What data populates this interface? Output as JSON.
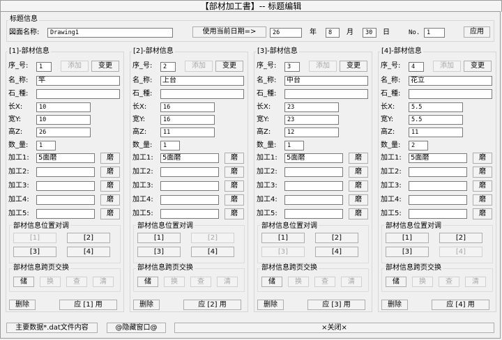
{
  "window": {
    "title": "【部材加工書】-- 标题编辑"
  },
  "header": {
    "group_title": "标题信息",
    "drawing_name_label": "図面名称:",
    "drawing_name_value": "Drawing1",
    "use_date_button": "使用当前日期=>",
    "year_value": "26",
    "year_label": "年",
    "month_value": "8",
    "month_label": "月",
    "day_value": "30",
    "day_label": "日",
    "no_label": "No.",
    "no_value": "1",
    "apply_button": "应用"
  },
  "labels": {
    "seq": "序_号:",
    "add": "添加",
    "change": "变更",
    "name": "名_称:",
    "stone": "石_種:",
    "length": "长X:",
    "width": "宽Y:",
    "height": "高Z:",
    "qty": "数_量:",
    "process": [
      "加工1:",
      "加工2:",
      "加工3:",
      "加工4:",
      "加工5:"
    ],
    "polish": "磨",
    "position_swap": "部材信息位置对调",
    "page_swap": "部材信息跨页交换",
    "swap_buttons": [
      "储",
      "换",
      "查",
      "清"
    ],
    "delete": "删除"
  },
  "panels": [
    {
      "title": "[1]-部材信息",
      "seq": "1",
      "name": "竿",
      "stone": "",
      "x": "10",
      "y": "10",
      "z": "26",
      "qty": "1",
      "process": [
        "5面磨",
        "",
        "",
        "",
        ""
      ],
      "pos_buttons": [
        "[1]",
        "[2]",
        "[3]",
        "[4]"
      ],
      "apply": "应 [1] 用"
    },
    {
      "title": "[2]-部材信息",
      "seq": "2",
      "name": "上台",
      "stone": "",
      "x": "16",
      "y": "16",
      "z": "11",
      "qty": "1",
      "process": [
        "5面磨",
        "",
        "",
        "",
        ""
      ],
      "pos_buttons": [
        "[1]",
        "[2]",
        "[3]",
        "[4]"
      ],
      "apply": "应 [2] 用"
    },
    {
      "title": "[3]-部材信息",
      "seq": "3",
      "name": "中台",
      "stone": "",
      "x": "23",
      "y": "23",
      "z": "12",
      "qty": "1",
      "process": [
        "5面磨",
        "",
        "",
        "",
        ""
      ],
      "pos_buttons": [
        "[1]",
        "[2]",
        "[3]",
        "[4]"
      ],
      "apply": "应 [3] 用"
    },
    {
      "title": "[4]-部材信息",
      "seq": "4",
      "name": "花立",
      "stone": "",
      "x": "5.5",
      "y": "5.5",
      "z": "11",
      "qty": "2",
      "process": [
        "5面磨",
        "",
        "",
        "",
        ""
      ],
      "pos_buttons": [
        "[1]",
        "[2]",
        "[3]",
        "[4]"
      ],
      "apply": "应 [4] 用"
    }
  ],
  "footer": {
    "main_data_button": "主要数据*.dat文件内容",
    "hide_window_button": "@隐藏窗口@",
    "close_button": "×关闭×"
  }
}
